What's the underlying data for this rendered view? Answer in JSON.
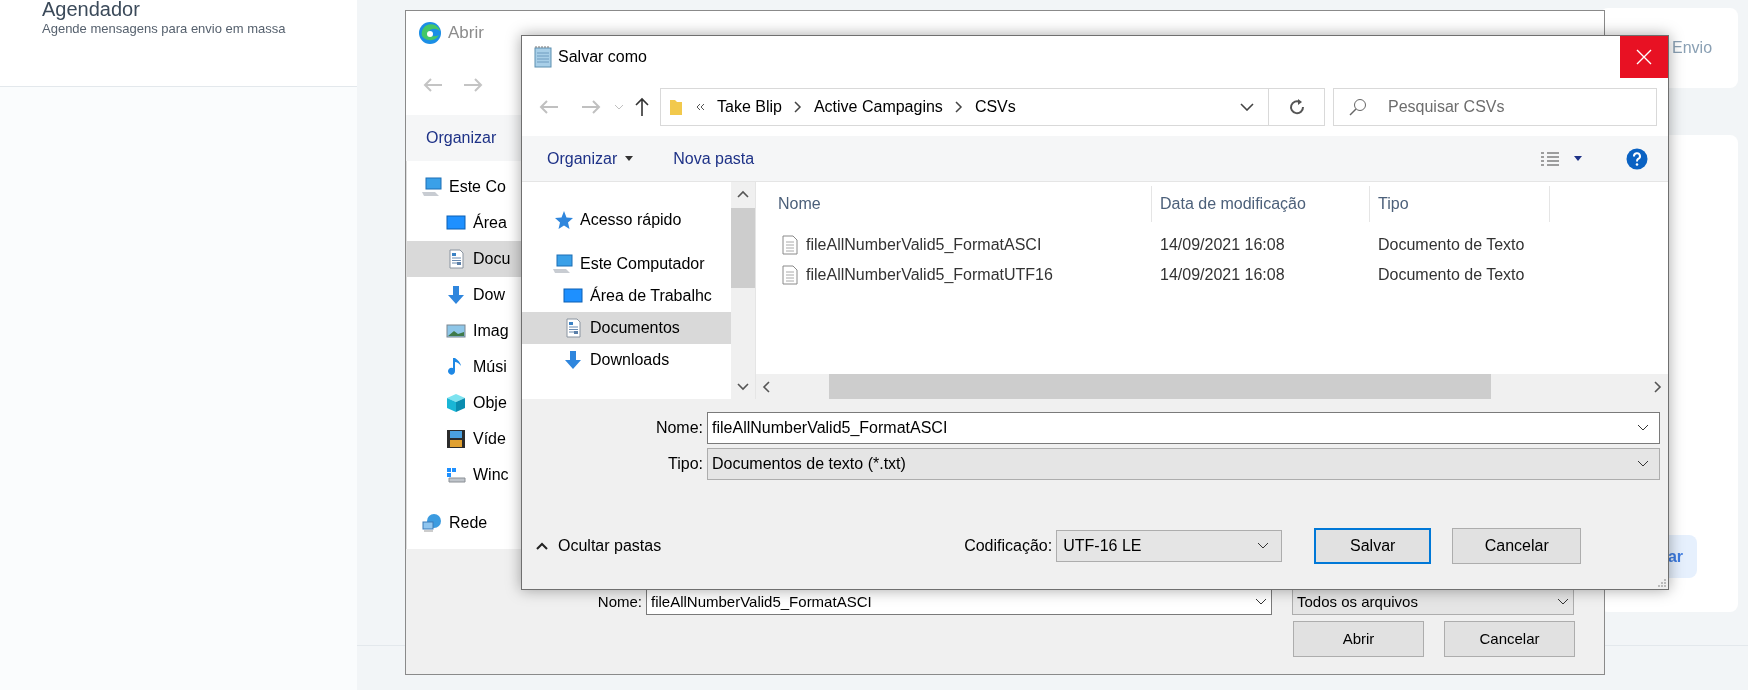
{
  "background_page": {
    "section_title": "Agendador",
    "section_subtitle": "Agende mensagens para envio em massa",
    "card_link": "Envio",
    "card_button": "ar"
  },
  "open_dialog": {
    "title": "Abrir",
    "toolbar_button": "Organizar",
    "tree": [
      {
        "label": "Este Co",
        "selected": false,
        "children": [
          {
            "label": "Área",
            "selected": false
          },
          {
            "label": "Docu",
            "selected": true
          },
          {
            "label": "Dow",
            "selected": false
          },
          {
            "label": "Imag",
            "selected": false
          },
          {
            "label": "Músi",
            "selected": false
          },
          {
            "label": "Obje",
            "selected": false
          },
          {
            "label": "Víde",
            "selected": false
          },
          {
            "label": "Winc",
            "selected": false
          }
        ]
      },
      {
        "label": "Rede",
        "selected": false
      }
    ],
    "name_label": "Nome:",
    "name_value": "fileAllNumberValid5_FormatASCI",
    "file_type": "Todos os arquivos",
    "buttons": [
      {
        "label": "Abrir",
        "default": false
      },
      {
        "label": "Cancelar",
        "default": false
      }
    ]
  },
  "save_dialog": {
    "title": "Salvar como",
    "breadcrumb": [
      "Take Blip",
      "Active Campagins",
      "CSVs"
    ],
    "search_placeholder": "Pesquisar CSVs",
    "toolbar": [
      "Organizar",
      "Nova pasta"
    ],
    "nav": [
      {
        "label": "Acesso rápido",
        "selected": false
      },
      {
        "label": "Este Computador",
        "selected": false,
        "children": [
          {
            "label": "Área de Trabalhc",
            "selected": false
          },
          {
            "label": "Documentos",
            "selected": true
          },
          {
            "label": "Downloads",
            "selected": false
          }
        ]
      }
    ],
    "columns": [
      "Nome",
      "Data de modificação",
      "Tipo"
    ],
    "rows": [
      {
        "name": "fileAllNumberValid5_FormatASCI",
        "date": "14/09/2021 16:08",
        "type": "Documento de Texto"
      },
      {
        "name": "fileAllNumberValid5_FormatUTF16",
        "date": "14/09/2021 16:08",
        "type": "Documento de Texto"
      }
    ],
    "name_label": "Nome:",
    "name_value": "fileAllNumberValid5_FormatASCI",
    "type_label": "Tipo:",
    "type_value": "Documentos de texto (*.txt)",
    "hide_folders": "Ocultar pastas",
    "encoding_label": "Codificação:",
    "encoding_value": "UTF-16 LE",
    "buttons": [
      {
        "label": "Salvar",
        "default": true
      },
      {
        "label": "Cancelar",
        "default": false
      }
    ]
  }
}
